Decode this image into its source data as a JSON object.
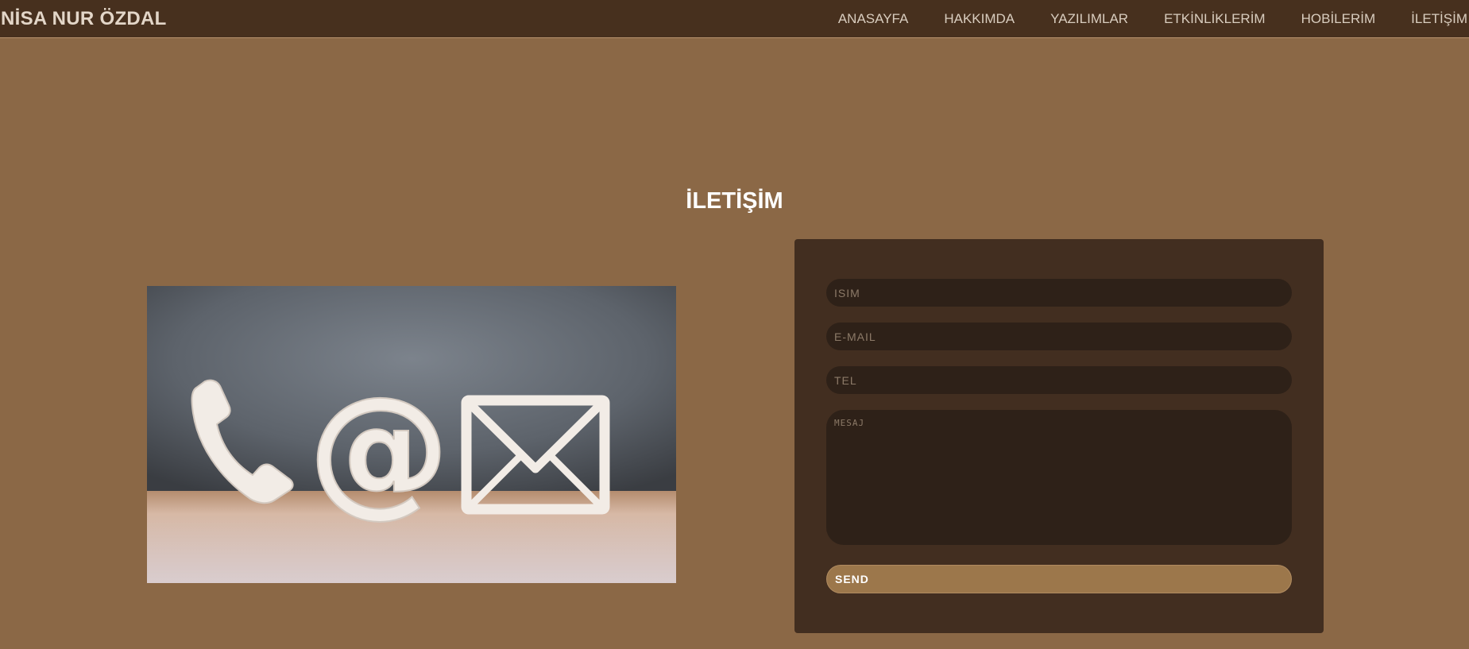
{
  "nav": {
    "brand": "NİSA NUR ÖZDAL",
    "links": [
      "ANASAYFA",
      "HAKKIMDA",
      "YAZILIMLAR",
      "ETKİNLİKLERİM",
      "HOBİLERİM",
      "İLETİŞİM"
    ]
  },
  "main": {
    "title": "İLETİŞİM",
    "image": {
      "icons": [
        "phone-icon",
        "at-sign-icon",
        "envelope-icon"
      ]
    }
  },
  "form": {
    "name_placeholder": "ISIM",
    "email_placeholder": "E-MAIL",
    "tel_placeholder": "TEL",
    "message_placeholder": "MESAJ",
    "send_label": "SEND"
  },
  "colors": {
    "page_bg": "#8b6846",
    "navbar_bg": "#47301e",
    "form_panel_bg": "#422e20",
    "input_bg": "#2e2118",
    "send_button_bg": "#9c774b"
  }
}
